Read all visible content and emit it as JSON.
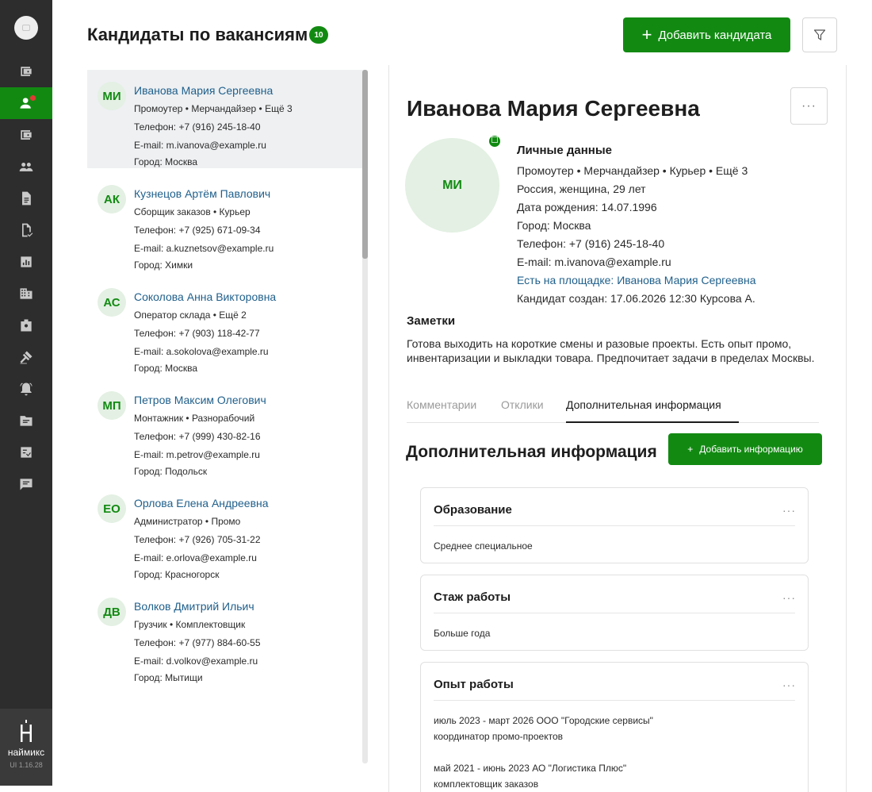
{
  "colors": {
    "accent": "#128a12",
    "sidebar": "#2d2d2d",
    "link": "#1f5f8b",
    "notification_dot": "#e53935"
  },
  "sidebar": {
    "items": [
      {
        "icon": "wallet-icon"
      },
      {
        "icon": "person-icon",
        "active": true
      },
      {
        "icon": "wallet-icon"
      },
      {
        "icon": "people-icon"
      },
      {
        "icon": "document-icon"
      },
      {
        "icon": "document-check-icon"
      },
      {
        "icon": "chart-icon"
      },
      {
        "icon": "building-icon"
      },
      {
        "icon": "badge-icon"
      },
      {
        "icon": "gavel-icon"
      },
      {
        "icon": "bell-icon"
      },
      {
        "icon": "folder-icon"
      },
      {
        "icon": "checklist-icon"
      },
      {
        "icon": "message-icon"
      }
    ],
    "brand": "наймикс",
    "version": "UI 1.16.28"
  },
  "header": {
    "title": "Кандидаты по вакансиям",
    "count": "10",
    "add_button": "Добавить кандидата"
  },
  "candidates": [
    {
      "initials": "МИ",
      "name": "Иванова Мария Сергеевна",
      "roles": "Промоутер • Мерчандайзер • Ещё 3",
      "phone": "Телефон: +7 (916) 245-18-40",
      "email": "E-mail: m.ivanova@example.ru",
      "city": "Город: Москва"
    },
    {
      "initials": "АК",
      "name": "Кузнецов Артём Павлович",
      "roles": "Сборщик заказов • Курьер",
      "phone": "Телефон: +7 (925) 671-09-34",
      "email": "E-mail: a.kuznetsov@example.ru",
      "city": "Город: Химки"
    },
    {
      "initials": "АС",
      "name": "Соколова Анна Викторовна",
      "roles": "Оператор склада • Ещё 2",
      "phone": "Телефон: +7 (903) 118-42-77",
      "email": "E-mail: a.sokolova@example.ru",
      "city": "Город: Москва"
    },
    {
      "initials": "МП",
      "name": "Петров Максим Олегович",
      "roles": "Монтажник • Разнорабочий",
      "phone": "Телефон: +7 (999) 430-82-16",
      "email": "E-mail: m.petrov@example.ru",
      "city": "Город: Подольск"
    },
    {
      "initials": "ЕО",
      "name": "Орлова Елена Андреевна",
      "roles": "Администратор • Промо",
      "phone": "Телефон: +7 (926) 705-31-22",
      "email": "E-mail: e.orlova@example.ru",
      "city": "Город: Красногорск"
    },
    {
      "initials": "ДВ",
      "name": "Волков Дмитрий Ильич",
      "roles": "Грузчик • Комплектовщик",
      "phone": "Телефон: +7 (977) 884-60-55",
      "email": "E-mail: d.volkov@example.ru",
      "city": "Город: Мытищи"
    }
  ],
  "detail": {
    "name": "Иванова Мария Сергеевна",
    "initials": "МИ",
    "personal_title": "Личные данные",
    "roles": "Промоутер • Мерчандайзер • Курьер • Ещё 3",
    "demographics": "Россия, женщина, 29 лет",
    "birth": "Дата рождения:  14.07.1996",
    "city": "Город:  Москва",
    "phone": "Телефон:  +7 (916) 245-18-40",
    "email": "E-mail:  m.ivanova@example.ru",
    "platform_label": "Есть на площадке:",
    "platform_link": "Иванова Мария Сергеевна",
    "created": "Кандидат создан:  17.06.2026 12:30 Курсова А.",
    "notes_title": "Заметки",
    "notes": "Готова выходить на короткие смены и разовые проекты. Есть опыт промо, инвентаризации и выкладки товара. Предпочитает задачи в пределах Москвы.",
    "tabs": [
      "Комментарии",
      "Отклики",
      "Дополнительная информация"
    ],
    "add_info_title": "Дополнительная информация",
    "add_info_button": "Добавить информацию",
    "cards": [
      {
        "title": "Образование",
        "lines": [
          "Среднее специальное"
        ]
      },
      {
        "title": "Стаж работы",
        "lines": [
          "Больше года"
        ]
      },
      {
        "title": "Опыт работы",
        "lines": [
          "июль 2023 - март 2026 ООО \"Городские сервисы\"",
          "координатор промо-проектов",
          "май 2021 - июнь 2023 АО \"Логистика Плюс\"",
          "комплектовщик заказов"
        ]
      }
    ]
  }
}
